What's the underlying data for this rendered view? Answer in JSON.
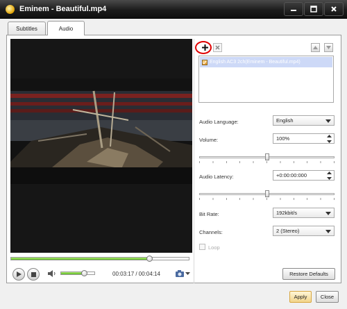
{
  "window": {
    "title": "Eminem - Beautiful.mp4",
    "controls": [
      "minimize-icon",
      "maximize-icon",
      "close-icon"
    ]
  },
  "tabs": [
    {
      "label": "Subtitles",
      "active": false
    },
    {
      "label": "Audio",
      "active": true
    }
  ],
  "player": {
    "time_display": "00:03:17 / 00:04:14",
    "progress": 0.776,
    "volume": 0.68,
    "icons": [
      "play-icon",
      "stop-icon",
      "speaker-icon",
      "camera-icon"
    ]
  },
  "audio_tracks": {
    "toolbar_icons": [
      "add-icon",
      "delete-icon",
      "move-up-icon",
      "move-down-icon"
    ],
    "items": [
      {
        "label": "English AC3 2ch(Eminem - Beautiful.mp4)",
        "checked": true,
        "selected": true
      }
    ]
  },
  "settings": {
    "audio_language_label": "Audio Language:",
    "audio_language_value": "English",
    "volume_label": "Volume:",
    "volume_value": "100%",
    "volume_slider": 0.5,
    "audio_latency_label": "Audio Latency:",
    "audio_latency_value": "+0:00:00:000",
    "latency_slider": 0.5,
    "bit_rate_label": "Bit Rate:",
    "bit_rate_value": "192kbit/s",
    "channels_label": "Channels:",
    "channels_value": "2 (Stereo)",
    "loop_label": "Loop",
    "loop_checked": false,
    "restore_defaults_label": "Restore Defaults"
  },
  "footer": {
    "apply_label": "Apply",
    "close_label": "Close"
  },
  "colors": {
    "progress_fill": "#55b51a",
    "selected_row": "#cdd9f7",
    "highlight_ring": "#e00000",
    "titlebar": "#1c1c1c"
  }
}
